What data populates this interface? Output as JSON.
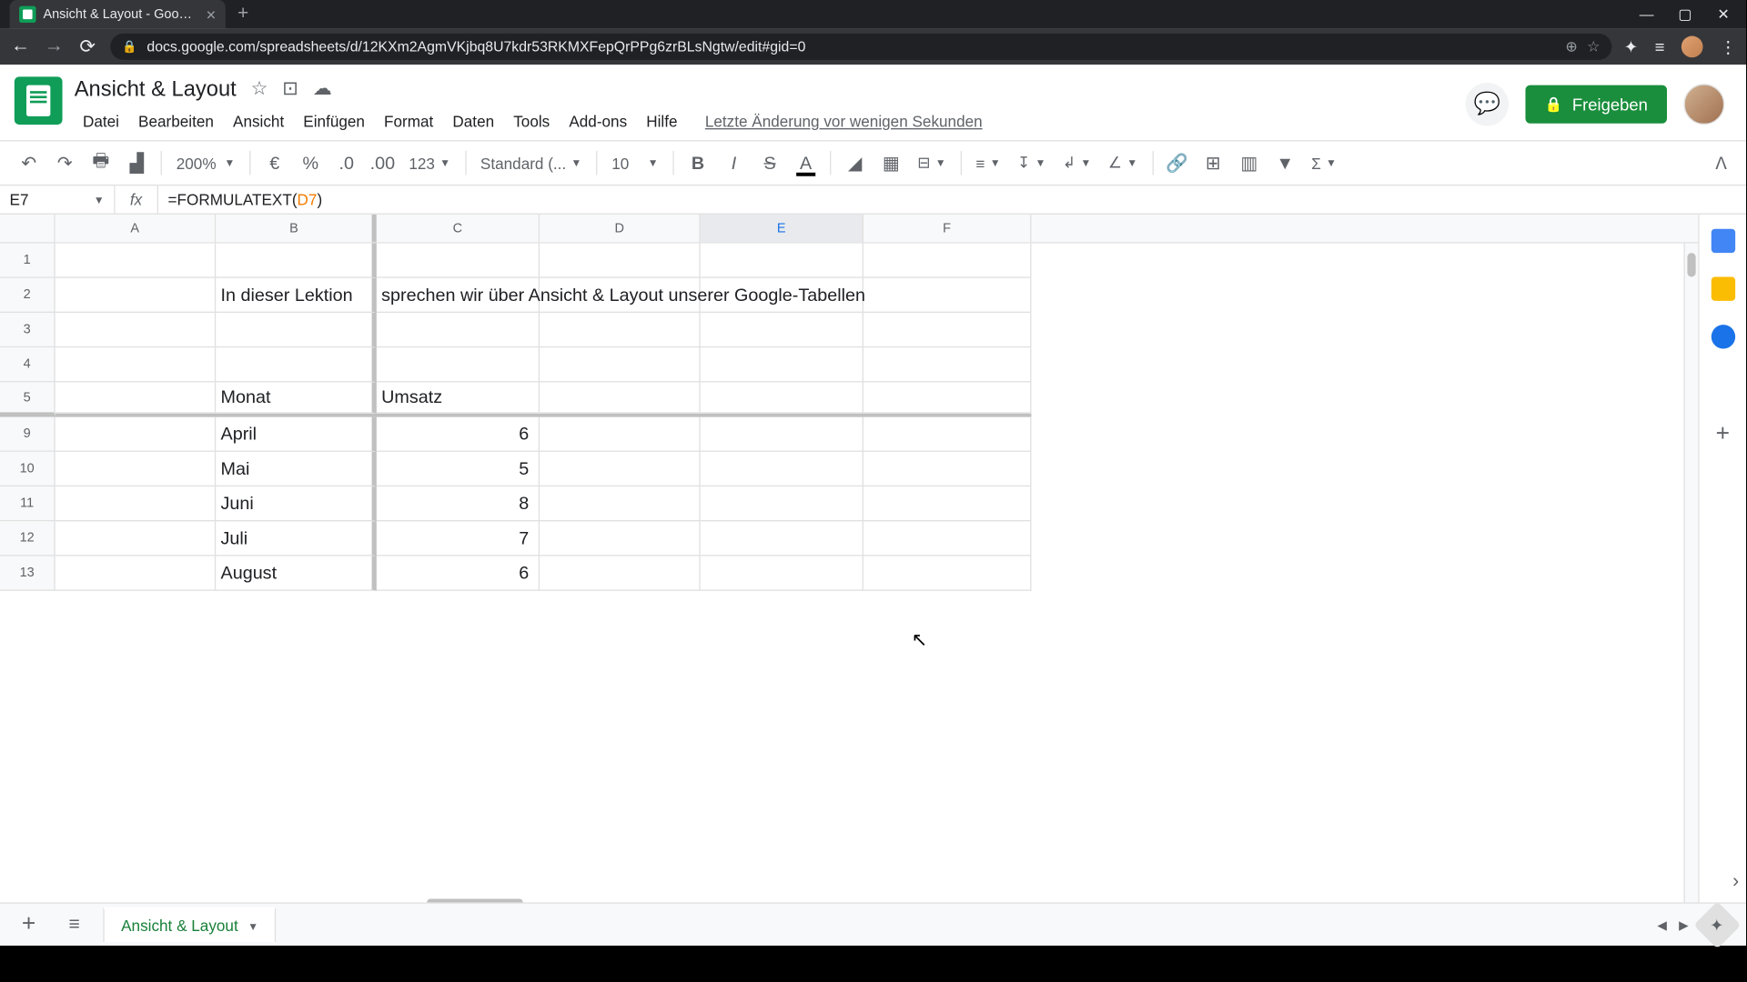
{
  "browser": {
    "tab_title": "Ansicht & Layout - Google Tabel",
    "url": "docs.google.com/spreadsheets/d/12KXm2AgmVKjbq8U7kdr53RKMXFepQrPPg6zrBLsNgtw/edit#gid=0"
  },
  "doc": {
    "title": "Ansicht & Layout",
    "last_edit": "Letzte Änderung vor wenigen Sekunden"
  },
  "menus": [
    "Datei",
    "Bearbeiten",
    "Ansicht",
    "Einfügen",
    "Format",
    "Daten",
    "Tools",
    "Add-ons",
    "Hilfe"
  ],
  "share_label": "Freigeben",
  "toolbar": {
    "zoom": "200%",
    "font": "Standard (...",
    "font_size": "10"
  },
  "formula_bar": {
    "cell_ref": "E7",
    "formula_prefix": "=FORMULATEXT(",
    "formula_ref": "D7",
    "formula_suffix": ")"
  },
  "columns": [
    "A",
    "B",
    "C",
    "D",
    "E",
    "F"
  ],
  "selected_column": "E",
  "row_numbers": [
    "1",
    "2",
    "3",
    "4",
    "5",
    "9",
    "10",
    "11",
    "12",
    "13"
  ],
  "content": {
    "row2_textB": "In dieser Lektion",
    "row2_textC": "sprechen wir über Ansicht & Layout unserer Google-Tabellen",
    "header_B": "Monat",
    "header_C": "Umsatz",
    "data_rows": [
      {
        "month": "April",
        "value": "6"
      },
      {
        "month": "Mai",
        "value": "5"
      },
      {
        "month": "Juni",
        "value": "8"
      },
      {
        "month": "Juli",
        "value": "7"
      },
      {
        "month": "August",
        "value": "6"
      }
    ]
  },
  "sheet_tab": "Ansicht & Layout"
}
